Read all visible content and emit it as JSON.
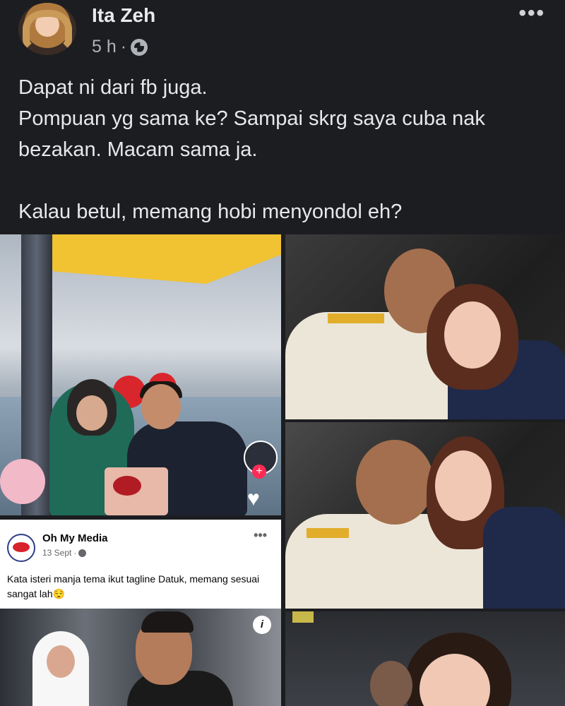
{
  "post": {
    "author": "Ita Zeh",
    "time": "5 h",
    "separator": "·",
    "more": "•••",
    "lines": [
      "Dapat ni dari fb juga.",
      "Pompuan yg sama ke? Sampai skrg saya cuba nak bezakan. Macam sama ja.",
      "Kalau betul, memang hobi menyondol eh?"
    ]
  },
  "shared": {
    "page_name": "Oh My Media",
    "date": "13 Sept",
    "separator": "·",
    "more": "•••",
    "caption": "Kata isteri manja tema ikut tagline Datuk, memang sesuai sangat lah😌",
    "info": "i"
  },
  "icons": {
    "plus": "+",
    "heart": "♥"
  }
}
